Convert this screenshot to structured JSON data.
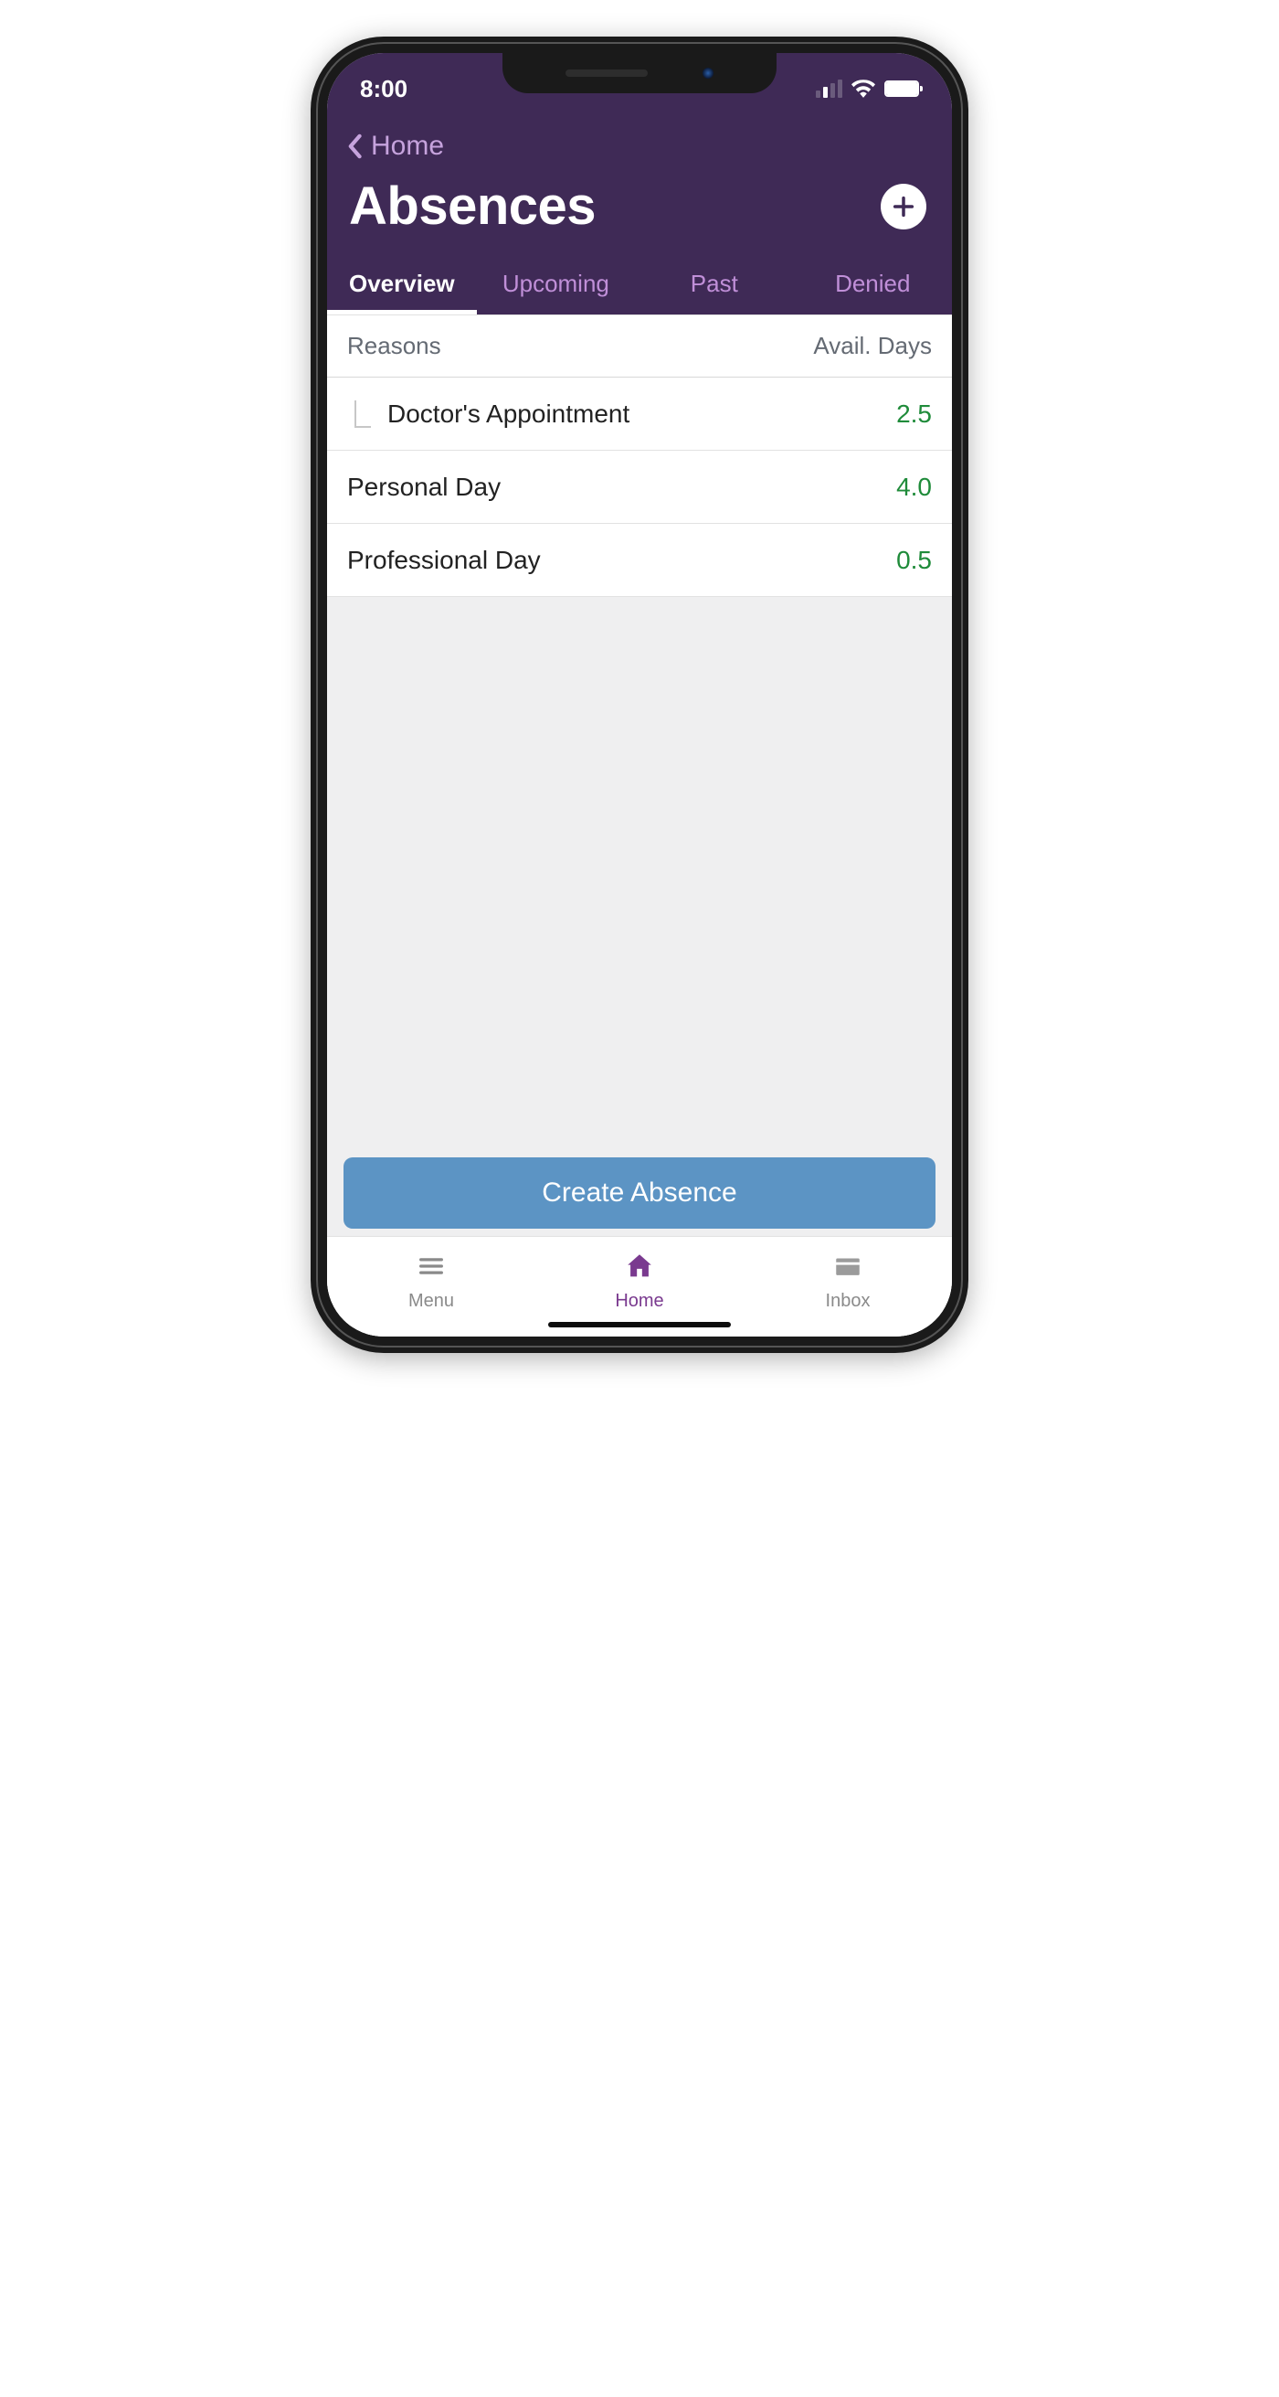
{
  "status_bar": {
    "time": "8:00"
  },
  "header": {
    "back_label": "Home",
    "title": "Absences"
  },
  "tabs": [
    {
      "label": "Overview",
      "active": true
    },
    {
      "label": "Upcoming",
      "active": false
    },
    {
      "label": "Past",
      "active": false
    },
    {
      "label": "Denied",
      "active": false
    }
  ],
  "table": {
    "head_reason": "Reasons",
    "head_value": "Avail. Days",
    "rows": [
      {
        "reason": "Doctor's Appointment",
        "value": "2.5",
        "indent": true
      },
      {
        "reason": "Personal Day",
        "value": "4.0",
        "indent": false
      },
      {
        "reason": "Professional Day",
        "value": "0.5",
        "indent": false
      }
    ]
  },
  "create_button_label": "Create Absence",
  "bottom_nav": [
    {
      "label": "Menu",
      "active": false
    },
    {
      "label": "Home",
      "active": true
    },
    {
      "label": "Inbox",
      "active": false
    }
  ]
}
